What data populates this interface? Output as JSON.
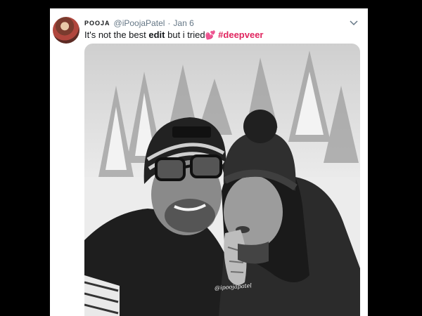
{
  "tweet": {
    "display_name": "POOJA",
    "handle": "@iPoojaPatel",
    "date": "Jan 6",
    "text_before": "It's not the best ",
    "text_bold": "edit",
    "text_after": " but i tried",
    "emoji": "💕",
    "hashtag": "#deepveer",
    "menu_icon": "chevron-down-icon",
    "photo_watermark": "@ipoojapatel"
  },
  "colors": {
    "background": "#000000",
    "card": "#ffffff",
    "secondary_text": "#657786",
    "hashtag": "#e0245e"
  }
}
